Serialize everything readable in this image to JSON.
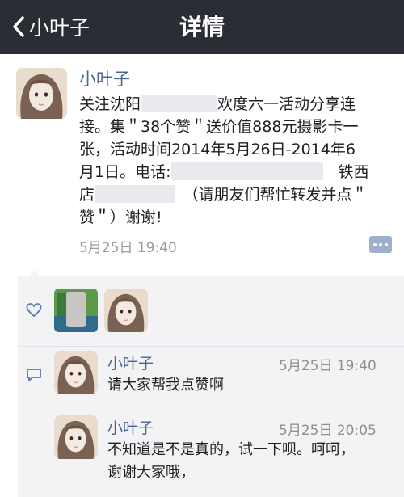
{
  "nav": {
    "back_label": "小叶子",
    "title": "详情"
  },
  "post": {
    "author": "小叶子",
    "text_line1_a": "关注沈阳",
    "text_line1_b": "欢度六一活动分享连",
    "text_line2": "接。集＂38个赞＂送价值888元摄影卡一",
    "text_line3": "张，活动时间2014年5月26日-2014年6",
    "text_line4_a": "月1日。电话:",
    "text_line4_b": "铁西",
    "text_line5_a": "店",
    "text_line5_b": "（请朋友们帮忙转发并点＂",
    "text_line6": "赞＂）谢谢!",
    "time": "5月25日 19:40"
  },
  "comments": [
    {
      "author": "小叶子",
      "time": "5月25日 19:40",
      "lines": [
        "请大家帮我点赞啊"
      ]
    },
    {
      "author": "小叶子",
      "time": "5月25日 20:05",
      "lines": [
        "不知道是不是真的，试一下呗。呵呵，",
        "谢谢大家哦，"
      ]
    }
  ],
  "icons": {
    "back": "chevron-left-icon",
    "like": "heart-outline-icon",
    "comment": "speech-bubble-icon",
    "more": "comment-dots-icon"
  },
  "colors": {
    "nav_bg": "#2a2e34",
    "name_blue": "#4a6693",
    "panel_bg": "#f3f3f5",
    "icon_blue": "#5a7ab2"
  }
}
